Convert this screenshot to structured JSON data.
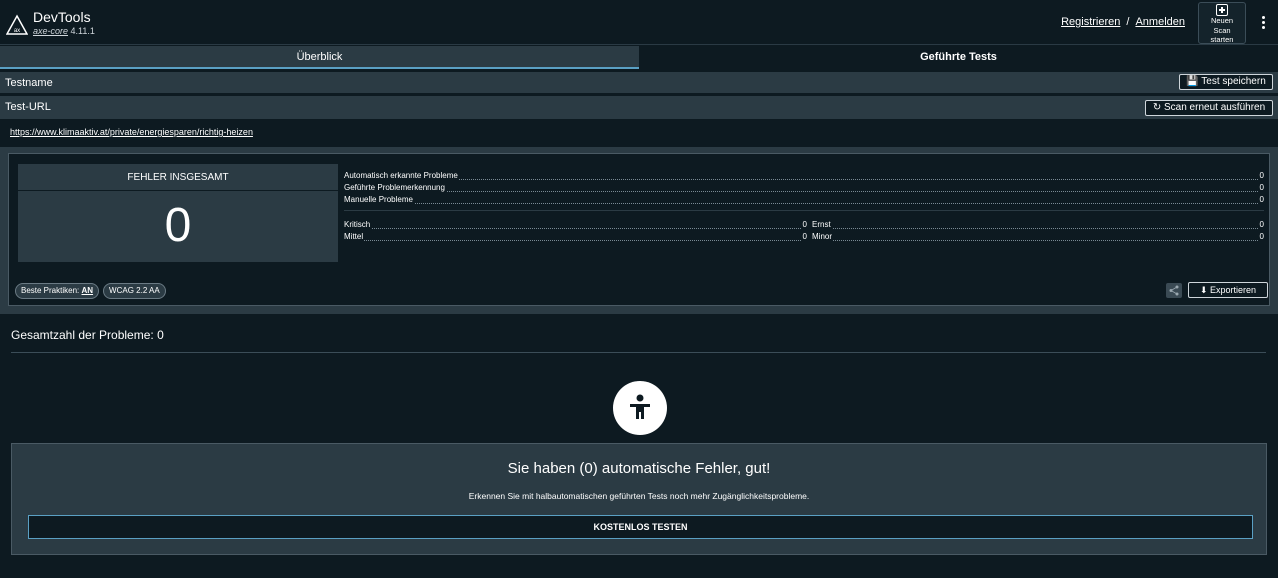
{
  "header": {
    "title": "DevTools",
    "version_link": "axe-core",
    "version": "4.11.1",
    "register": "Registrieren",
    "separator": "/",
    "login": "Anmelden",
    "new_scan": [
      "Neuen",
      "Scan",
      "starten"
    ]
  },
  "tabs": [
    {
      "label": "Überblick",
      "active": true
    },
    {
      "label": "Geführte Tests",
      "active": false
    }
  ],
  "test": {
    "name_label": "Testname",
    "save_button": "Test speichern",
    "url_label": "Test-URL",
    "rescan_button": "Scan erneut ausführen",
    "url": "https://www.klimaaktiv.at/private/energiesparen/richtig-heizen"
  },
  "summary": {
    "total_label": "FEHLER INSGESAMT",
    "total_value": "0",
    "categories": [
      {
        "label": "Automatisch erkannte Probleme",
        "value": "0"
      },
      {
        "label": "Geführte Problemerkennung",
        "value": "0"
      },
      {
        "label": "Manuelle Probleme",
        "value": "0"
      }
    ],
    "severity": {
      "critical_label": "Kritisch",
      "critical_value": "0",
      "serious_label": "Ernst",
      "serious_value": "0",
      "moderate_label": "Mittel",
      "moderate_value": "0",
      "minor_label": "Minor",
      "minor_value": "0"
    },
    "chip_best_practices_label": "Beste Praktiken:",
    "chip_best_practices_value": "AN",
    "chip_wcag": "WCAG 2.2 AA",
    "export_button": "Exportieren"
  },
  "issues": {
    "title": "Gesamtzahl der Probleme: 0",
    "cta_heading": "Sie haben (0) automatische Fehler, gut!",
    "cta_text": "Erkennen Sie mit halbautomatischen geführten Tests noch mehr Zugänglichkeitsprobleme.",
    "cta_button": "KOSTENLOS TESTEN"
  },
  "colors": {
    "background": "#0d1a21",
    "panel": "#2b3b44",
    "accent": "#5aa0c4"
  }
}
